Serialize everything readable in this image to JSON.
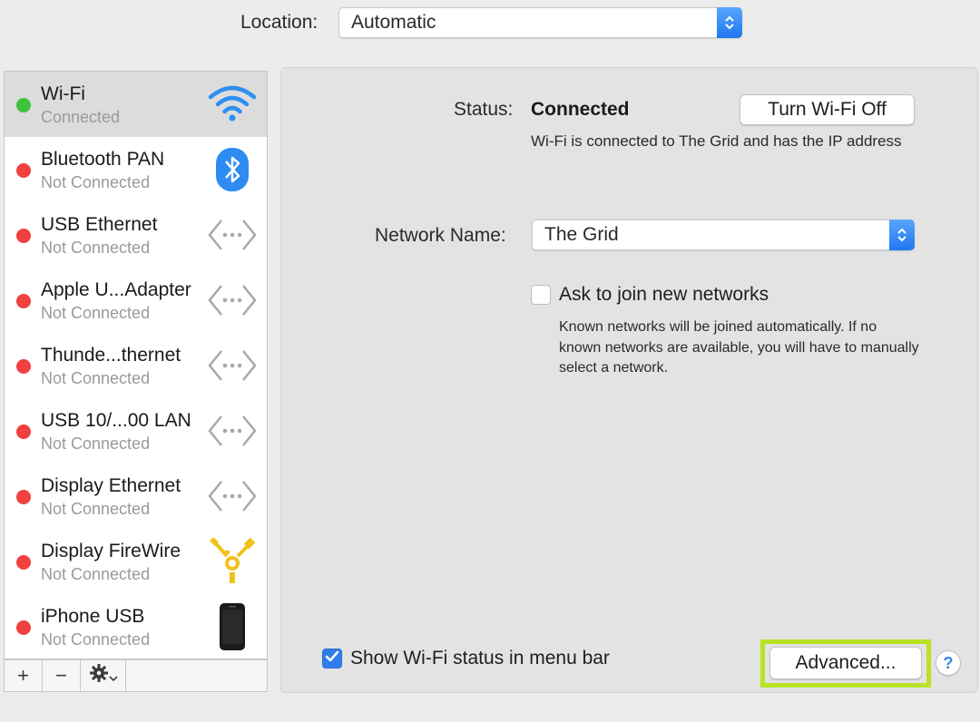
{
  "location": {
    "label": "Location:",
    "value": "Automatic"
  },
  "services": [
    {
      "name": "Wi-Fi",
      "status": "Connected",
      "icon": "wifi-icon",
      "status_color": "#3cc23c",
      "selected": true
    },
    {
      "name": "Bluetooth PAN",
      "status": "Not Connected",
      "icon": "bluetooth-icon",
      "status_color": "#f04040",
      "selected": false
    },
    {
      "name": "USB Ethernet",
      "status": "Not Connected",
      "icon": "ethernet-icon",
      "status_color": "#f04040",
      "selected": false
    },
    {
      "name": "Apple U...Adapter",
      "status": "Not Connected",
      "icon": "ethernet-icon",
      "status_color": "#f04040",
      "selected": false
    },
    {
      "name": "Thunde...thernet",
      "status": "Not Connected",
      "icon": "ethernet-icon",
      "status_color": "#f04040",
      "selected": false
    },
    {
      "name": "USB 10/...00 LAN",
      "status": "Not Connected",
      "icon": "ethernet-icon",
      "status_color": "#f04040",
      "selected": false
    },
    {
      "name": "Display Ethernet",
      "status": "Not Connected",
      "icon": "ethernet-icon",
      "status_color": "#f04040",
      "selected": false
    },
    {
      "name": "Display FireWire",
      "status": "Not Connected",
      "icon": "firewire-icon",
      "status_color": "#f04040",
      "selected": false
    },
    {
      "name": "iPhone USB",
      "status": "Not Connected",
      "icon": "iphone-icon",
      "status_color": "#f04040",
      "selected": false
    }
  ],
  "sidebar_toolbar": {
    "add": "+",
    "remove": "−"
  },
  "detail": {
    "status_label": "Status:",
    "status_value": "Connected",
    "turn_off_label": "Turn Wi-Fi Off",
    "status_description": "Wi-Fi is connected to The Grid and has the IP address",
    "network_name_label": "Network Name:",
    "network_name_value": "The Grid",
    "ask_join_label": "Ask to join new networks",
    "ask_join_checked": false,
    "ask_join_description": "Known networks will be joined automatically. If no known networks are available, you will have to manually select a network.",
    "show_status_label": "Show Wi-Fi status in menu bar",
    "show_status_checked": true,
    "advanced_label": "Advanced...",
    "help_label": "?"
  },
  "colors": {
    "accent": "#2f7de8",
    "highlight": "#b8e224",
    "connected": "#3cc23c",
    "not_connected": "#f04040"
  }
}
